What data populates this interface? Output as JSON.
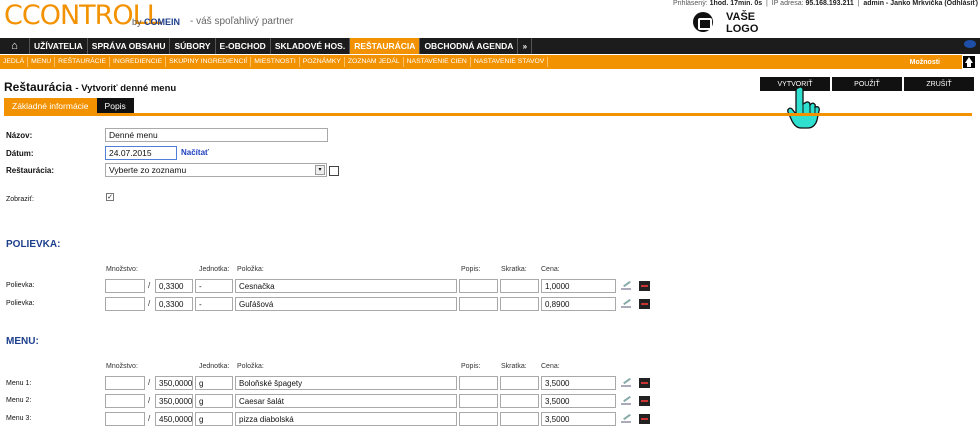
{
  "header": {
    "logo_text": "CCONTROLL",
    "logo_by": "by",
    "logo_company": "COMEIN",
    "tagline": "- váš spoľahlivý partner",
    "session_label_logged": "Prihlásený:",
    "session_time": "1hod. 17min. 0s",
    "session_ip_label": "IP adresa:",
    "session_ip": "95.168.193.211",
    "session_user": "admin - Janko Mrkvička",
    "session_logout": "(Odhlásiť)",
    "client_logo": "VAŠE LOGO"
  },
  "main_nav": {
    "home_icon": "home-icon",
    "items": [
      {
        "label": "UŽÍVATELIA"
      },
      {
        "label": "SPRÁVA OBSAHU"
      },
      {
        "label": "SÚBORY"
      },
      {
        "label": "E-OBCHOD"
      },
      {
        "label": "SKLADOVÉ HOS."
      },
      {
        "label": "REŠTAURÁCIA",
        "active": true
      },
      {
        "label": "OBCHODNÁ AGENDA"
      }
    ],
    "more": "»"
  },
  "sub_nav": {
    "items": [
      "JEDLÁ",
      "MENU",
      "REŠTAURÁCIE",
      "INGREDIENCIE",
      "SKUPINY INGREDIENCIÍ",
      "MIESTNOSTI",
      "POZNÁMKY",
      "ZOZNAM JEDÁL",
      "NASTAVENIE CIEN",
      "NASTAVENIE STAVOV"
    ],
    "options": "Možnosti"
  },
  "page": {
    "title": "Reštaurácia",
    "subtitle": "- Vytvoriť denné menu",
    "actions": {
      "create": "VYTVORIŤ",
      "apply": "POUŽIŤ",
      "cancel": "ZRUŠIŤ"
    },
    "tabs": [
      {
        "label": "Základné informácie",
        "active": true
      },
      {
        "label": "Popis",
        "active": false
      }
    ]
  },
  "form": {
    "name_label": "Názov:",
    "name_value": "Denné menu",
    "date_label": "Dátum:",
    "date_value": "24.07.2015",
    "load_link": "Načítať",
    "restaurant_label": "Reštaurácia:",
    "restaurant_value": "Vyberte zo zoznamu",
    "show_label": "Zobraziť:",
    "show_checked": "✓"
  },
  "columns": {
    "quantity": "Množstvo:",
    "unit": "Jednotka:",
    "item": "Položka:",
    "description": "Popis:",
    "abbr": "Skratka:",
    "price": "Cena:"
  },
  "soups": {
    "title": "POLIEVKA:",
    "rows": [
      {
        "label": "Polievka:",
        "qty": "",
        "amount": "0,3300",
        "unit": "-",
        "item": "Cesnačka",
        "desc": "",
        "abbr": "",
        "price": "1,0000"
      },
      {
        "label": "Polievka:",
        "qty": "",
        "amount": "0,3300",
        "unit": "-",
        "item": "Guľášová",
        "desc": "",
        "abbr": "",
        "price": "0,8900"
      }
    ]
  },
  "menu": {
    "title": "MENU:",
    "rows": [
      {
        "label": "Menu 1:",
        "qty": "",
        "amount": "350,0000",
        "unit": "g",
        "item": "Boloňské špagety",
        "desc": "",
        "abbr": "",
        "price": "3,5000"
      },
      {
        "label": "Menu 2:",
        "qty": "",
        "amount": "350,0000",
        "unit": "g",
        "item": "Caesar šalát",
        "desc": "",
        "abbr": "",
        "price": "3,5000"
      },
      {
        "label": "Menu 3:",
        "qty": "",
        "amount": "450,0000",
        "unit": "g",
        "item": "pizza diabolská",
        "desc": "",
        "abbr": "",
        "price": "3,5000"
      }
    ]
  }
}
